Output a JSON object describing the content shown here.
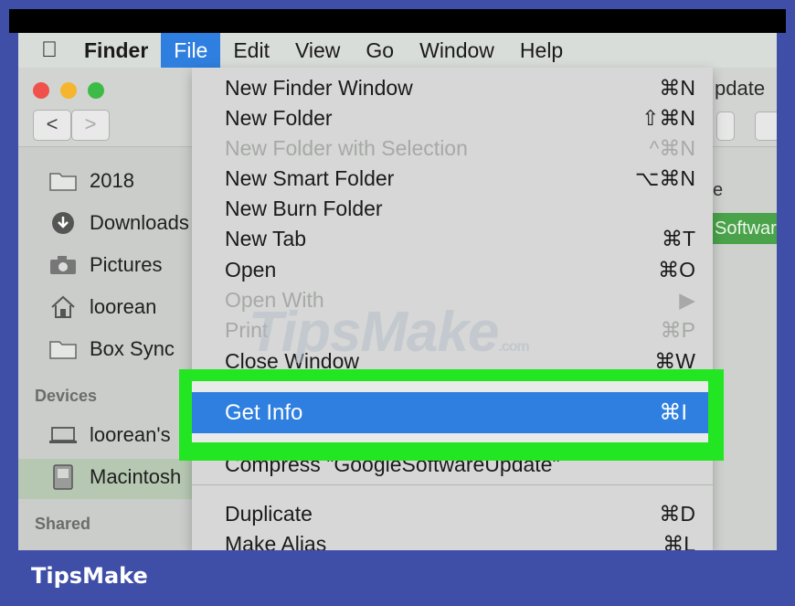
{
  "menubar": {
    "apple": "",
    "items": [
      "Finder",
      "File",
      "Edit",
      "View",
      "Go",
      "Window",
      "Help"
    ]
  },
  "window": {
    "title_partial": "pdate",
    "nav_back": "<",
    "nav_forward": ">"
  },
  "sidebar": {
    "items": [
      {
        "label": "2018",
        "icon": "folder-icon"
      },
      {
        "label": "Downloads",
        "icon": "download-icon"
      },
      {
        "label": "Pictures",
        "icon": "camera-icon"
      },
      {
        "label": "loorean",
        "icon": "home-icon"
      },
      {
        "label": "Box Sync",
        "icon": "folder-icon"
      }
    ],
    "devices_header": "Devices",
    "devices": [
      {
        "label": "loorean's",
        "icon": "laptop-icon"
      },
      {
        "label": "Macintosh",
        "icon": "disk-icon"
      }
    ],
    "shared_header": "Shared"
  },
  "right_pane": {
    "row1": "e",
    "selected": "Software"
  },
  "file_menu": {
    "items": [
      {
        "label": "New Finder Window",
        "shortcut": "⌘N",
        "disabled": false
      },
      {
        "label": "New Folder",
        "shortcut": "⇧⌘N",
        "disabled": false
      },
      {
        "label": "New Folder with Selection",
        "shortcut": "^⌘N",
        "disabled": true
      },
      {
        "label": "New Smart Folder",
        "shortcut": "⌥⌘N",
        "disabled": false
      },
      {
        "label": "New Burn Folder",
        "shortcut": "",
        "disabled": false
      },
      {
        "label": "New Tab",
        "shortcut": "⌘T",
        "disabled": false
      },
      {
        "label": "Open",
        "shortcut": "⌘O",
        "disabled": false
      },
      {
        "label": "Open With",
        "shortcut": "▶",
        "disabled": true
      },
      {
        "label": "Print",
        "shortcut": "⌘P",
        "disabled": true
      },
      {
        "label": "Close Window",
        "shortcut": "⌘W",
        "disabled": false
      }
    ],
    "selected": {
      "label": "Get Info",
      "shortcut": "⌘I"
    },
    "after": [
      {
        "label": "Compress \"GoogleSoftwareUpdate\"",
        "shortcut": ""
      },
      {
        "label": "Duplicate",
        "shortcut": "⌘D"
      },
      {
        "label": "Make Alias",
        "shortcut": "⌘L"
      }
    ]
  },
  "watermark": {
    "text": "TipsMake",
    "suffix": ".com"
  },
  "footer": {
    "brand": "TipsMake"
  },
  "colors": {
    "highlight": "#2f7fe0",
    "callout": "#22e622",
    "frame": "#3f4fa8"
  }
}
